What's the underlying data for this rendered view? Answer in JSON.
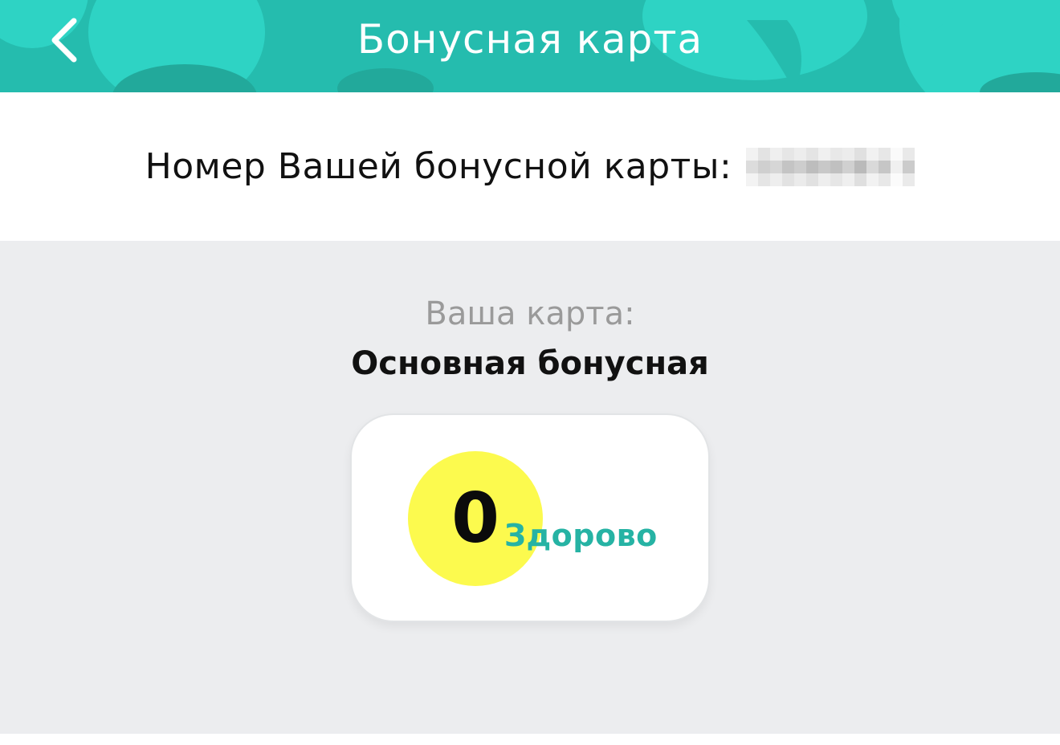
{
  "header": {
    "title": "Бонусная карта",
    "back_icon": "chevron-left-icon",
    "background_color": "#25bfb0",
    "accent_color": "#2ed3c4"
  },
  "card_number": {
    "label": "Номер Вашей бонусной карты:"
  },
  "card_info": {
    "label": "Ваша карта:",
    "name": "Основная бонусная"
  },
  "balance": {
    "value": "0",
    "caption": "Здорово",
    "circle_color": "#fcfa4e",
    "caption_color": "#26b3a4"
  }
}
